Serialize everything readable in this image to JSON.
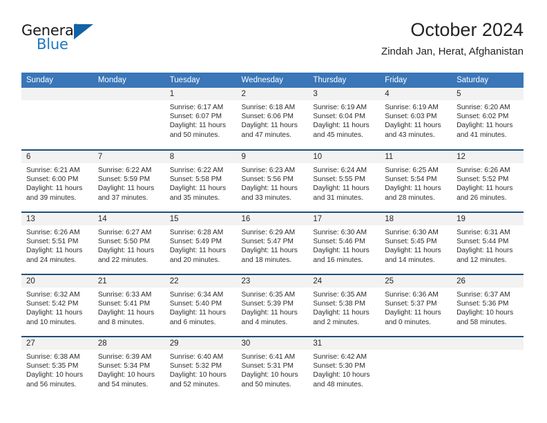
{
  "branding": {
    "logo_text_primary": "General",
    "logo_text_secondary": "Blue",
    "logo_icon": "triangle-icon",
    "accent_color": "#1262a8",
    "header_color": "#3a76b8",
    "separator_color": "#1f4e79"
  },
  "header": {
    "month_title": "October 2024",
    "location": "Zindah Jan, Herat, Afghanistan"
  },
  "calendar": {
    "weekday_headers": [
      "Sunday",
      "Monday",
      "Tuesday",
      "Wednesday",
      "Thursday",
      "Friday",
      "Saturday"
    ],
    "weeks": [
      [
        {
          "day": "",
          "blank": true
        },
        {
          "day": "",
          "blank": true
        },
        {
          "day": "1",
          "sunrise": "Sunrise: 6:17 AM",
          "sunset": "Sunset: 6:07 PM",
          "daylight_line1": "Daylight: 11 hours",
          "daylight_line2": "and 50 minutes."
        },
        {
          "day": "2",
          "sunrise": "Sunrise: 6:18 AM",
          "sunset": "Sunset: 6:06 PM",
          "daylight_line1": "Daylight: 11 hours",
          "daylight_line2": "and 47 minutes."
        },
        {
          "day": "3",
          "sunrise": "Sunrise: 6:19 AM",
          "sunset": "Sunset: 6:04 PM",
          "daylight_line1": "Daylight: 11 hours",
          "daylight_line2": "and 45 minutes."
        },
        {
          "day": "4",
          "sunrise": "Sunrise: 6:19 AM",
          "sunset": "Sunset: 6:03 PM",
          "daylight_line1": "Daylight: 11 hours",
          "daylight_line2": "and 43 minutes."
        },
        {
          "day": "5",
          "sunrise": "Sunrise: 6:20 AM",
          "sunset": "Sunset: 6:02 PM",
          "daylight_line1": "Daylight: 11 hours",
          "daylight_line2": "and 41 minutes."
        }
      ],
      [
        {
          "day": "6",
          "sunrise": "Sunrise: 6:21 AM",
          "sunset": "Sunset: 6:00 PM",
          "daylight_line1": "Daylight: 11 hours",
          "daylight_line2": "and 39 minutes."
        },
        {
          "day": "7",
          "sunrise": "Sunrise: 6:22 AM",
          "sunset": "Sunset: 5:59 PM",
          "daylight_line1": "Daylight: 11 hours",
          "daylight_line2": "and 37 minutes."
        },
        {
          "day": "8",
          "sunrise": "Sunrise: 6:22 AM",
          "sunset": "Sunset: 5:58 PM",
          "daylight_line1": "Daylight: 11 hours",
          "daylight_line2": "and 35 minutes."
        },
        {
          "day": "9",
          "sunrise": "Sunrise: 6:23 AM",
          "sunset": "Sunset: 5:56 PM",
          "daylight_line1": "Daylight: 11 hours",
          "daylight_line2": "and 33 minutes."
        },
        {
          "day": "10",
          "sunrise": "Sunrise: 6:24 AM",
          "sunset": "Sunset: 5:55 PM",
          "daylight_line1": "Daylight: 11 hours",
          "daylight_line2": "and 31 minutes."
        },
        {
          "day": "11",
          "sunrise": "Sunrise: 6:25 AM",
          "sunset": "Sunset: 5:54 PM",
          "daylight_line1": "Daylight: 11 hours",
          "daylight_line2": "and 28 minutes."
        },
        {
          "day": "12",
          "sunrise": "Sunrise: 6:26 AM",
          "sunset": "Sunset: 5:52 PM",
          "daylight_line1": "Daylight: 11 hours",
          "daylight_line2": "and 26 minutes."
        }
      ],
      [
        {
          "day": "13",
          "sunrise": "Sunrise: 6:26 AM",
          "sunset": "Sunset: 5:51 PM",
          "daylight_line1": "Daylight: 11 hours",
          "daylight_line2": "and 24 minutes."
        },
        {
          "day": "14",
          "sunrise": "Sunrise: 6:27 AM",
          "sunset": "Sunset: 5:50 PM",
          "daylight_line1": "Daylight: 11 hours",
          "daylight_line2": "and 22 minutes."
        },
        {
          "day": "15",
          "sunrise": "Sunrise: 6:28 AM",
          "sunset": "Sunset: 5:49 PM",
          "daylight_line1": "Daylight: 11 hours",
          "daylight_line2": "and 20 minutes."
        },
        {
          "day": "16",
          "sunrise": "Sunrise: 6:29 AM",
          "sunset": "Sunset: 5:47 PM",
          "daylight_line1": "Daylight: 11 hours",
          "daylight_line2": "and 18 minutes."
        },
        {
          "day": "17",
          "sunrise": "Sunrise: 6:30 AM",
          "sunset": "Sunset: 5:46 PM",
          "daylight_line1": "Daylight: 11 hours",
          "daylight_line2": "and 16 minutes."
        },
        {
          "day": "18",
          "sunrise": "Sunrise: 6:30 AM",
          "sunset": "Sunset: 5:45 PM",
          "daylight_line1": "Daylight: 11 hours",
          "daylight_line2": "and 14 minutes."
        },
        {
          "day": "19",
          "sunrise": "Sunrise: 6:31 AM",
          "sunset": "Sunset: 5:44 PM",
          "daylight_line1": "Daylight: 11 hours",
          "daylight_line2": "and 12 minutes."
        }
      ],
      [
        {
          "day": "20",
          "sunrise": "Sunrise: 6:32 AM",
          "sunset": "Sunset: 5:42 PM",
          "daylight_line1": "Daylight: 11 hours",
          "daylight_line2": "and 10 minutes."
        },
        {
          "day": "21",
          "sunrise": "Sunrise: 6:33 AM",
          "sunset": "Sunset: 5:41 PM",
          "daylight_line1": "Daylight: 11 hours",
          "daylight_line2": "and 8 minutes."
        },
        {
          "day": "22",
          "sunrise": "Sunrise: 6:34 AM",
          "sunset": "Sunset: 5:40 PM",
          "daylight_line1": "Daylight: 11 hours",
          "daylight_line2": "and 6 minutes."
        },
        {
          "day": "23",
          "sunrise": "Sunrise: 6:35 AM",
          "sunset": "Sunset: 5:39 PM",
          "daylight_line1": "Daylight: 11 hours",
          "daylight_line2": "and 4 minutes."
        },
        {
          "day": "24",
          "sunrise": "Sunrise: 6:35 AM",
          "sunset": "Sunset: 5:38 PM",
          "daylight_line1": "Daylight: 11 hours",
          "daylight_line2": "and 2 minutes."
        },
        {
          "day": "25",
          "sunrise": "Sunrise: 6:36 AM",
          "sunset": "Sunset: 5:37 PM",
          "daylight_line1": "Daylight: 11 hours",
          "daylight_line2": "and 0 minutes."
        },
        {
          "day": "26",
          "sunrise": "Sunrise: 6:37 AM",
          "sunset": "Sunset: 5:36 PM",
          "daylight_line1": "Daylight: 10 hours",
          "daylight_line2": "and 58 minutes."
        }
      ],
      [
        {
          "day": "27",
          "sunrise": "Sunrise: 6:38 AM",
          "sunset": "Sunset: 5:35 PM",
          "daylight_line1": "Daylight: 10 hours",
          "daylight_line2": "and 56 minutes."
        },
        {
          "day": "28",
          "sunrise": "Sunrise: 6:39 AM",
          "sunset": "Sunset: 5:34 PM",
          "daylight_line1": "Daylight: 10 hours",
          "daylight_line2": "and 54 minutes."
        },
        {
          "day": "29",
          "sunrise": "Sunrise: 6:40 AM",
          "sunset": "Sunset: 5:32 PM",
          "daylight_line1": "Daylight: 10 hours",
          "daylight_line2": "and 52 minutes."
        },
        {
          "day": "30",
          "sunrise": "Sunrise: 6:41 AM",
          "sunset": "Sunset: 5:31 PM",
          "daylight_line1": "Daylight: 10 hours",
          "daylight_line2": "and 50 minutes."
        },
        {
          "day": "31",
          "sunrise": "Sunrise: 6:42 AM",
          "sunset": "Sunset: 5:30 PM",
          "daylight_line1": "Daylight: 10 hours",
          "daylight_line2": "and 48 minutes."
        },
        {
          "day": "",
          "blank": true
        },
        {
          "day": "",
          "blank": true
        }
      ]
    ]
  }
}
